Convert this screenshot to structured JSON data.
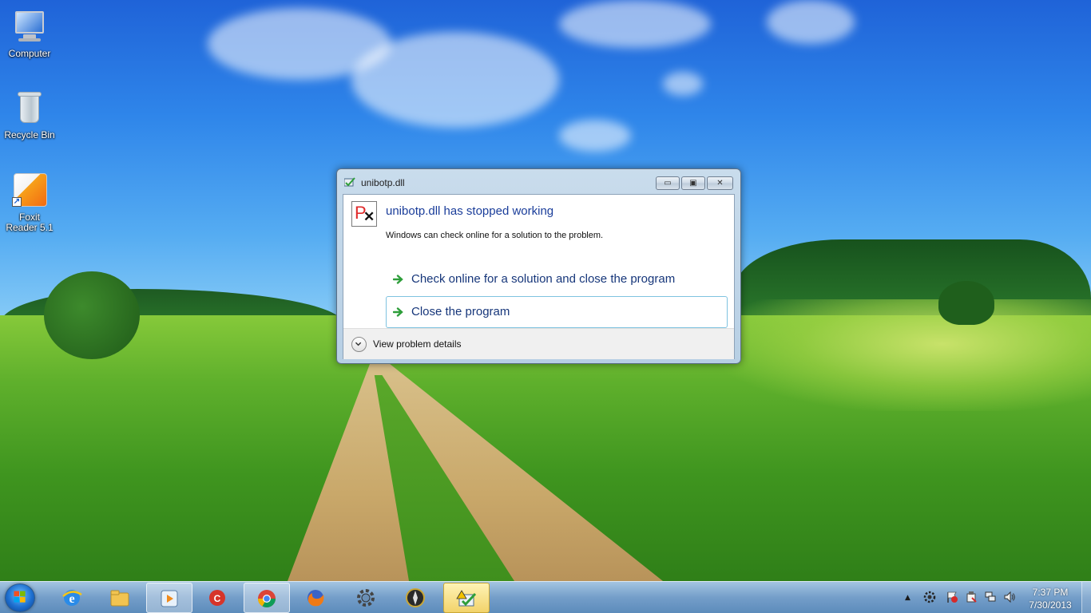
{
  "desktop": {
    "icons": [
      {
        "label": "Computer",
        "icon": "computer-icon"
      },
      {
        "label": "Recycle Bin",
        "icon": "recycle-bin-icon"
      },
      {
        "label": "Foxit Reader 5.1",
        "icon": "foxit-reader-icon"
      }
    ]
  },
  "dialog": {
    "title": "unibotp.dll",
    "headline": "unibotp.dll has stopped working",
    "message": "Windows can check online for a solution to the problem.",
    "options": [
      {
        "label": "Check online for a solution and close the program"
      },
      {
        "label": "Close the program"
      }
    ],
    "details_label": "View problem details",
    "buttons": {
      "minimize": "▭",
      "maximize": "▣",
      "close": "✕"
    }
  },
  "taskbar": {
    "pinned": [
      {
        "name": "internet-explorer"
      },
      {
        "name": "windows-explorer"
      },
      {
        "name": "media-player"
      },
      {
        "name": "ccleaner"
      },
      {
        "name": "chrome"
      },
      {
        "name": "firefox"
      },
      {
        "name": "settings-gear"
      },
      {
        "name": "compass-app"
      },
      {
        "name": "error-reporting"
      }
    ],
    "clock": {
      "time": "7:37 PM",
      "date": "7/30/2013"
    }
  },
  "colors": {
    "accent_link": "#16367a",
    "headline": "#1a3d9a",
    "focus_border": "#7fc3e0",
    "arrow_green": "#2e9e3a"
  }
}
